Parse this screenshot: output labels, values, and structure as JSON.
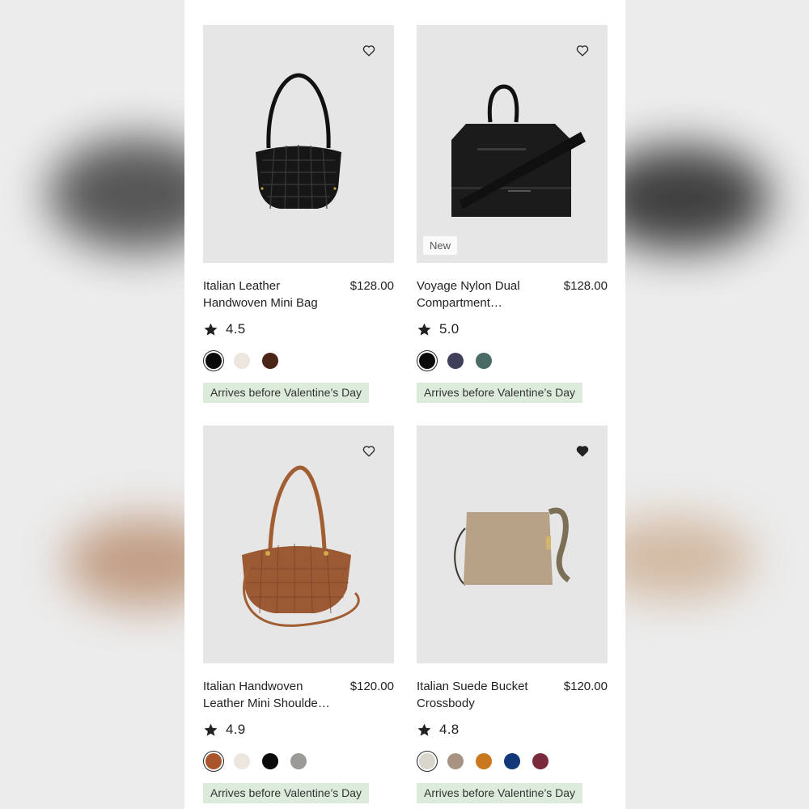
{
  "products": [
    {
      "name": "Italian Leather Handwoven Mini Bag",
      "price": "$128.00",
      "rating": "4.5",
      "favorited": false,
      "badge": "",
      "colors": [
        "#0a0a0a",
        "#ece6de",
        "#4a2417"
      ],
      "selected_color": 0,
      "delivery": "Arrives before Valentine’s Day"
    },
    {
      "name": "Voyage Nylon Dual Compartment…",
      "price": "$128.00",
      "rating": "5.0",
      "favorited": false,
      "badge": "New",
      "colors": [
        "#0a0a0a",
        "#3f3f5a",
        "#4a6a64"
      ],
      "selected_color": 0,
      "delivery": "Arrives before Valentine’s Day"
    },
    {
      "name": "Italian Handwoven Leather Mini Shoulde…",
      "price": "$120.00",
      "rating": "4.9",
      "favorited": false,
      "badge": "",
      "colors": [
        "#a9542a",
        "#ece6de",
        "#0a0a0a",
        "#9c9a97"
      ],
      "selected_color": 0,
      "delivery": "Arrives before Valentine’s Day"
    },
    {
      "name": "Italian Suede Bucket Crossbody",
      "price": "$120.00",
      "rating": "4.8",
      "favorited": true,
      "badge": "",
      "colors": [
        "#d9d5cc",
        "#a89383",
        "#c9781e",
        "#12387a",
        "#7b2a3c"
      ],
      "selected_color": 0,
      "delivery": "Arrives before Valentine’s Day"
    }
  ],
  "icons": {
    "favorite": "heart-icon",
    "rating": "star-icon"
  }
}
